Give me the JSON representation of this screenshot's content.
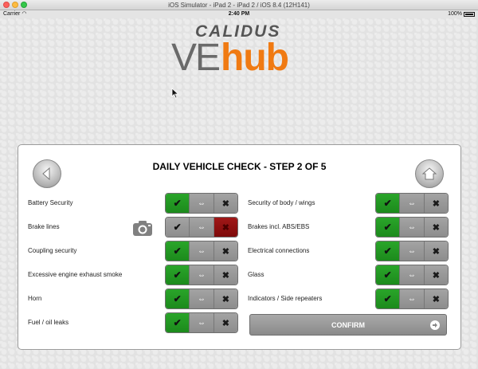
{
  "window": {
    "title": "iOS Simulator - iPad 2 - iPad 2 / iOS 8.4 (12H141)"
  },
  "status": {
    "carrier": "Carrier",
    "time": "2:40 PM",
    "battery": "100%"
  },
  "logo": {
    "top": "CALIDUS",
    "ve": "VE",
    "hub": "hub"
  },
  "panel": {
    "title": "DAILY VEHICLE CHECK - STEP 2 OF 5",
    "confirm_label": "CONFIRM"
  },
  "glyphs": {
    "pass": "✔",
    "na": "⇔",
    "fail": "✖"
  },
  "checks_left": [
    {
      "label": "Battery Security",
      "state": "pass"
    },
    {
      "label": "Brake lines",
      "state": "fail"
    },
    {
      "label": "Coupling security",
      "state": "pass"
    },
    {
      "label": "Excessive engine exhaust smoke",
      "state": "pass"
    },
    {
      "label": "Horn",
      "state": "pass"
    },
    {
      "label": "Fuel / oil leaks",
      "state": "pass"
    }
  ],
  "checks_right": [
    {
      "label": "Security of body / wings",
      "state": "pass"
    },
    {
      "label": "Brakes incl. ABS/EBS",
      "state": "pass"
    },
    {
      "label": "Electrical connections",
      "state": "pass"
    },
    {
      "label": "Glass",
      "state": "pass"
    },
    {
      "label": "Indicators / Side repeaters",
      "state": "pass"
    }
  ],
  "colors": {
    "pass": "#1c8a1c",
    "fail": "#8a0c0c",
    "accent": "#f07a12"
  }
}
